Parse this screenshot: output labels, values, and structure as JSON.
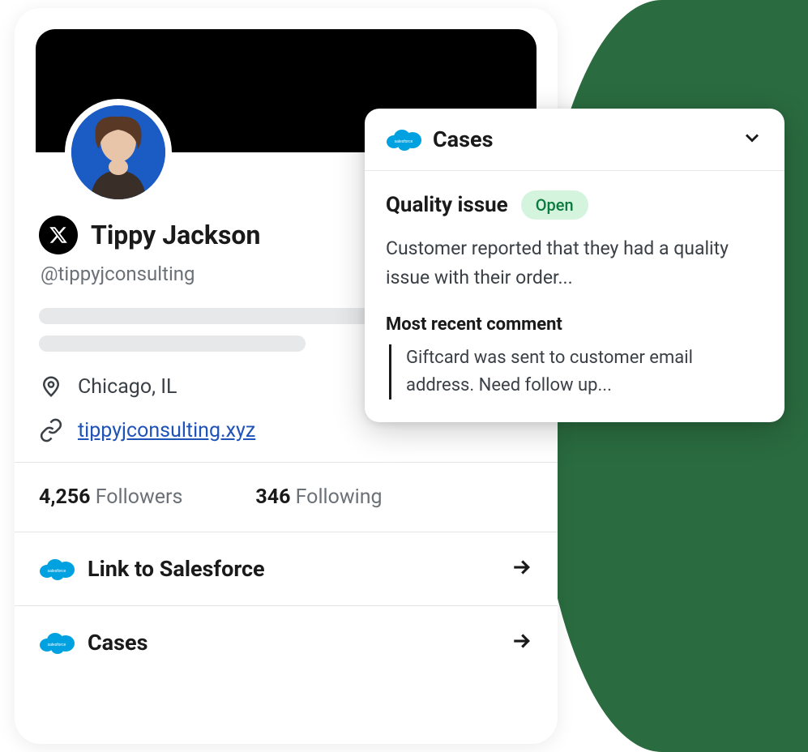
{
  "profile": {
    "displayName": "Tippy Jackson",
    "handle": "@tippyjconsulting",
    "location": "Chicago, IL",
    "website": "tippyjconsulting.xyz",
    "followersCount": "4,256",
    "followersLabel": "Followers",
    "followingCount": "346",
    "followingLabel": "Following"
  },
  "actions": {
    "linkToSalesforce": "Link to Salesforce",
    "cases": "Cases"
  },
  "casesPanel": {
    "headerTitle": "Cases",
    "caseTitle": "Quality issue",
    "status": "Open",
    "description": "Customer reported that they had a quality issue with their order...",
    "commentLabel": "Most recent comment",
    "commentText": "Giftcard was sent to customer email address. Need follow up..."
  },
  "icons": {
    "xLogo": "x-logo",
    "locationPin": "location-pin",
    "link": "link-icon",
    "salesforce": "salesforce-cloud",
    "arrowRight": "arrow-right",
    "chevronDown": "chevron-down"
  }
}
